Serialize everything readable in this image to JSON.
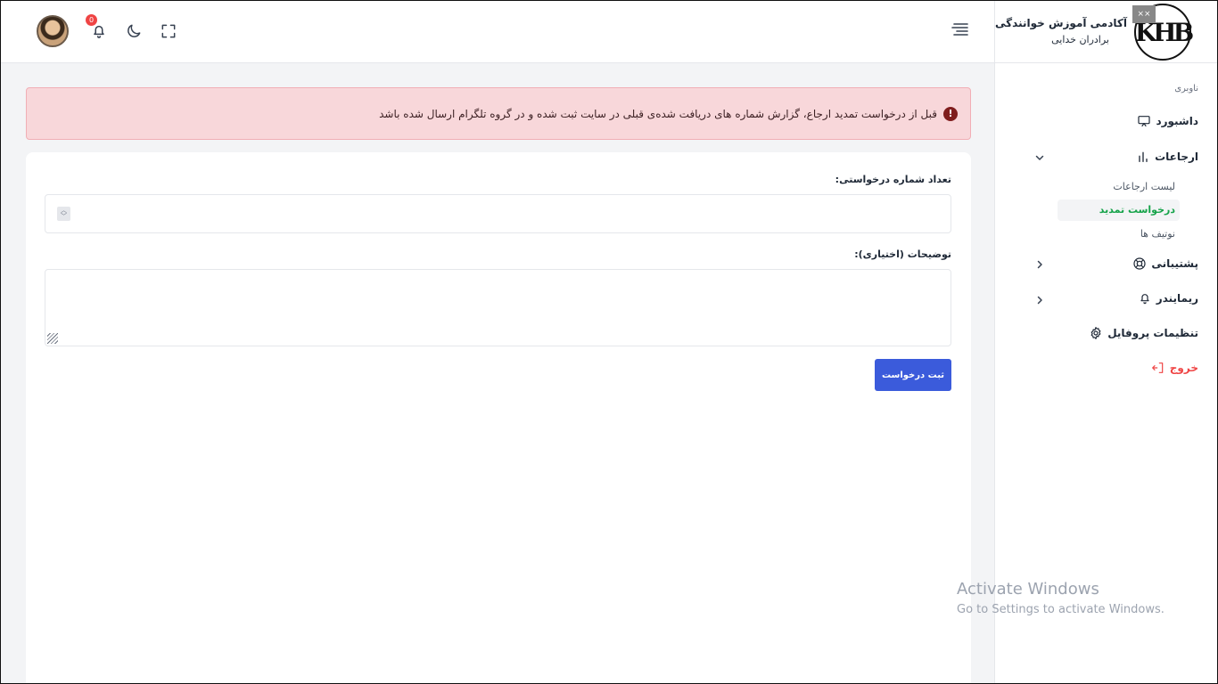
{
  "brand": {
    "title": "آکادمی آموزش خوانندگی",
    "subtitle": "برادران خدایی",
    "logo_text": "KHB"
  },
  "header": {
    "notification_count": "0"
  },
  "sidebar": {
    "caption": "ناوبری",
    "items": [
      {
        "label": "داشبورد",
        "icon": "monitor-icon"
      },
      {
        "label": "ارجاعات",
        "icon": "bar-chart-icon"
      },
      {
        "label": "پشتیبانی",
        "icon": "lifebuoy-icon"
      },
      {
        "label": "ریمایندر",
        "icon": "bell-icon"
      },
      {
        "label": "تنظیمات پروفایل",
        "icon": "gear-icon"
      },
      {
        "label": "خروج",
        "icon": "logout-icon"
      }
    ],
    "sub_items": [
      {
        "label": "لیست ارجاعات"
      },
      {
        "label": "درخواست تمدید"
      },
      {
        "label": "نوتیف ها"
      }
    ]
  },
  "alert": {
    "text": "قبل از درخواست تمدید ارجاع، گزارش شماره های دریافت شده‌ی قبلی در سایت ثبت شده و در گروه تلگرام ارسال شده باشد"
  },
  "form": {
    "count_label": "تعداد شماره درخواستی:",
    "count_value": "",
    "notes_label": "توضیحات (اختیاری):",
    "notes_value": "",
    "submit_label": "ثبت درخواست"
  },
  "watermark": {
    "line1": "Activate Windows",
    "line2": "Go to Settings to activate Windows."
  },
  "colors": {
    "accent": "#3b5bdb",
    "alert_bg": "#f8d7da",
    "active_sub": "#16a34a",
    "logout": "#ef4444"
  }
}
